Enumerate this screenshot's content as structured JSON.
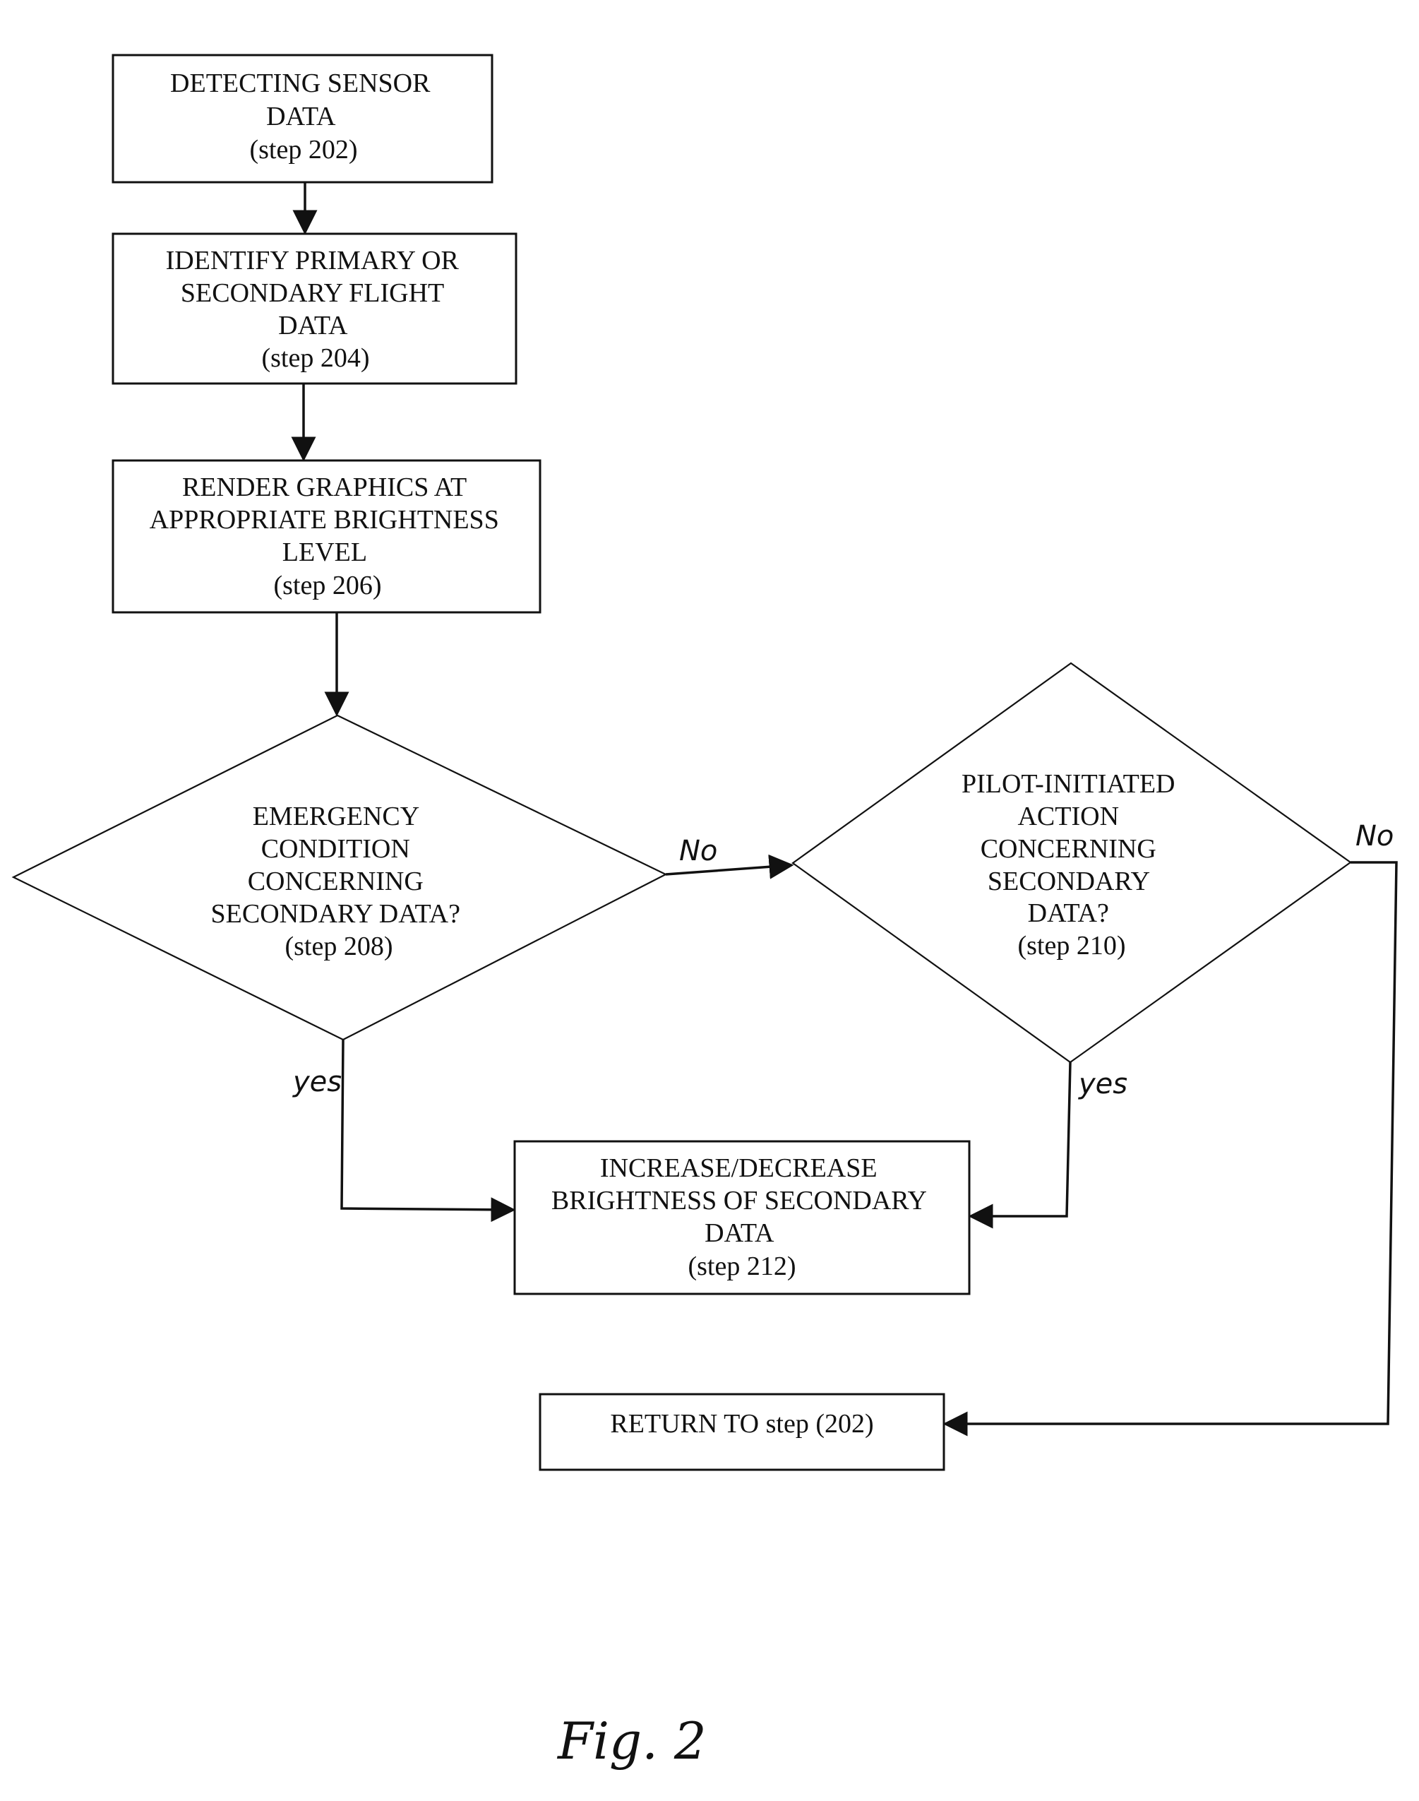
{
  "figure_label": "Fig. 2",
  "nodes": {
    "step202": {
      "lines": [
        "DETECTING SENSOR",
        "DATA",
        "(step 202)"
      ]
    },
    "step204": {
      "lines": [
        "IDENTIFY PRIMARY OR",
        "SECONDARY FLIGHT",
        "DATA",
        "(step 204)"
      ]
    },
    "step206": {
      "lines": [
        "RENDER GRAPHICS AT",
        "APPROPRIATE BRIGHTNESS",
        "LEVEL",
        "(step 206)"
      ]
    },
    "step208": {
      "lines": [
        "EMERGENCY",
        "CONDITION",
        "CONCERNING",
        "SECONDARY DATA?",
        "(step 208)"
      ]
    },
    "step210": {
      "lines": [
        "PILOT-INITIATED",
        "ACTION",
        "CONCERNING",
        "SECONDARY",
        "DATA?",
        "(step 210)"
      ]
    },
    "step212": {
      "lines": [
        "INCREASE/DECREASE",
        "BRIGHTNESS OF SECONDARY",
        "DATA",
        "(step 212)"
      ]
    },
    "return": {
      "lines": [
        "RETURN TO step (202)"
      ]
    }
  },
  "edge_labels": {
    "e208_no": "No",
    "e208_yes": "yes",
    "e210_no": "No",
    "e210_yes": "yes"
  }
}
